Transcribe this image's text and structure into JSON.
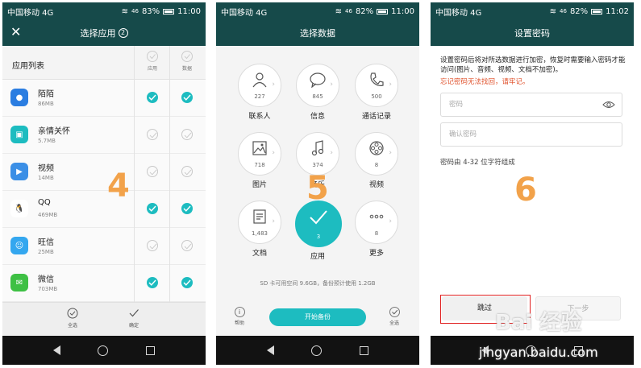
{
  "status": {
    "carrier": "中国移动 4G",
    "signal": "46",
    "panels": [
      {
        "battery": "83%",
        "battery_level": 0.83,
        "time": "11:00"
      },
      {
        "battery": "82%",
        "battery_level": 0.82,
        "time": "11:00"
      },
      {
        "battery": "82%",
        "battery_level": 0.82,
        "time": "11:02"
      }
    ]
  },
  "colors": {
    "accent": "#1dbcc0",
    "header": "#164a4a",
    "warn": "#e0512b",
    "step": "#f2a24a",
    "highlight": "#e02020"
  },
  "panel1": {
    "title": "选择应用",
    "title_badge": "2",
    "list_title": "应用列表",
    "col_app": "应用",
    "col_data": "数据",
    "apps": [
      {
        "name": "陌陌",
        "size": "86MB",
        "app": true,
        "data": true,
        "color": "#2a7de1",
        "icon": "momo-icon"
      },
      {
        "name": "亲情关怀",
        "size": "5.7MB",
        "app": false,
        "data": false,
        "color": "#1dbcc0",
        "icon": "care-icon"
      },
      {
        "name": "视频",
        "size": "14MB",
        "app": false,
        "data": false,
        "color": "#3b8fe6",
        "icon": "video-icon"
      },
      {
        "name": "QQ",
        "size": "469MB",
        "app": true,
        "data": true,
        "color": "#ffffff",
        "icon": "qq-icon"
      },
      {
        "name": "旺信",
        "size": "25MB",
        "app": false,
        "data": false,
        "color": "#34a7ef",
        "icon": "wangxin-icon"
      },
      {
        "name": "微信",
        "size": "703MB",
        "app": true,
        "data": true,
        "color": "#3ec044",
        "icon": "wechat-icon"
      }
    ],
    "select_all": "全选",
    "confirm": "确定",
    "step": "4"
  },
  "panel2": {
    "title": "选择数据",
    "categories": [
      {
        "label": "联系人",
        "count": "227",
        "icon": "contacts-icon",
        "selected": false
      },
      {
        "label": "信息",
        "count": "845",
        "icon": "message-icon",
        "selected": false
      },
      {
        "label": "通话记录",
        "count": "500",
        "icon": "phone-icon",
        "selected": false
      },
      {
        "label": "图片",
        "count": "718",
        "icon": "picture-icon",
        "selected": false
      },
      {
        "label": "音乐",
        "count": "374",
        "icon": "music-icon",
        "selected": false
      },
      {
        "label": "视频",
        "count": "8",
        "icon": "film-icon",
        "selected": false
      },
      {
        "label": "文档",
        "count": "1,483",
        "icon": "document-icon",
        "selected": false
      },
      {
        "label": "应用",
        "count": "3",
        "icon": "check-icon",
        "selected": true
      },
      {
        "label": "更多",
        "count": "8",
        "icon": "more-icon",
        "selected": false
      }
    ],
    "sd_info": "SD 卡可用空间 9.6GB，备份预计使用 1.2GB",
    "start": "开始备份",
    "help": "帮助",
    "select_all": "全选",
    "step": "5"
  },
  "panel3": {
    "title": "设置密码",
    "description": "设置密码后将对所选数据进行加密，恢复时需要输入密码才能访问(图片、音频、视频、文档不加密)。",
    "warning": "忘记密码无法找回，请牢记。",
    "password_placeholder": "密码",
    "confirm_placeholder": "确认密码",
    "hint": "密码由 4-32 位字符组成",
    "skip": "跳过",
    "next": "下一步",
    "step": "6"
  },
  "watermark": {
    "logo": "Bai 经验",
    "url": "jingyan.baidu.com"
  }
}
